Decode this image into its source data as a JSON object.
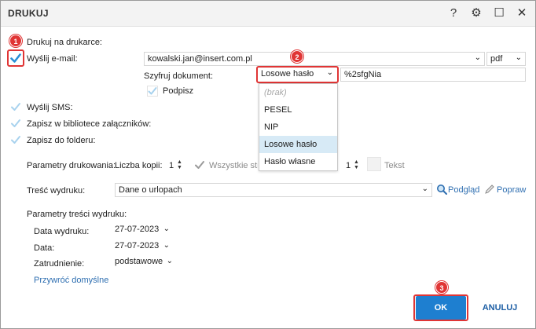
{
  "window": {
    "title": "DRUKUJ",
    "help_glyph": "?",
    "settings_glyph": "⚙",
    "maximize_glyph": "☐",
    "close_glyph": "✕"
  },
  "print": {
    "label": "Drukuj na drukarce:"
  },
  "email": {
    "label": "Wyślij e-mail:",
    "address": "kowalski.jan@insert.com.pl",
    "format": "pdf",
    "encrypt_label": "Szyfruj dokument:",
    "encrypt_value": "Losowe hasło",
    "password": "%2sfgNia",
    "sign_label": "Podpisz"
  },
  "encrypt_options": [
    "(brak)",
    "PESEL",
    "NIP",
    "Losowe hasło",
    "Hasło własne"
  ],
  "sms": {
    "label": "Wyślij SMS:"
  },
  "library": {
    "label": "Zapisz w bibliotece załączników:"
  },
  "folder": {
    "label": "Zapisz do folderu:"
  },
  "print_params": {
    "label": "Parametry drukowania:",
    "copies_label": "Liczba kopii:",
    "copies_value": "1",
    "all_label": "Wszystkie stro",
    "second_value": "1",
    "text_label": "Tekst"
  },
  "content": {
    "label": "Treść wydruku:",
    "value": "Dane o urlopach",
    "preview_label": "Podgląd",
    "edit_label": "Popraw"
  },
  "content_params": {
    "label": "Parametry treści wydruku:",
    "print_date_label": "Data wydruku:",
    "print_date_value": "27-07-2023",
    "date_label": "Data:",
    "date_value": "27-07-2023",
    "employment_label": "Zatrudnienie:",
    "employment_value": "podstawowe",
    "restore_label": "Przywróć domyślne"
  },
  "buttons": {
    "ok": "OK",
    "cancel": "ANULUJ"
  },
  "badges": [
    "1",
    "2",
    "3"
  ],
  "colors": {
    "accent": "#1e7fd0",
    "badge": "#e03535",
    "check": "#2a8fd6",
    "check_faded": "#a8d2ee"
  }
}
